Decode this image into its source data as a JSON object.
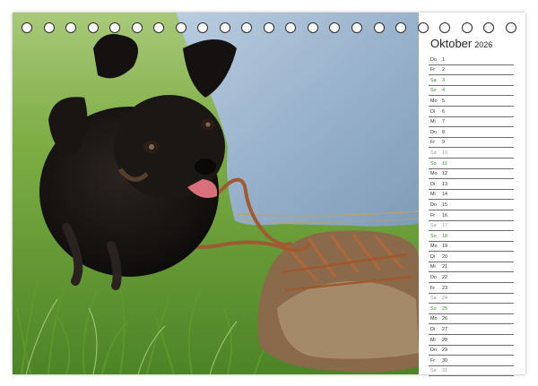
{
  "calendar": {
    "month": "Oktober",
    "year": "2026",
    "ring_count": 23,
    "days": [
      {
        "wd": "Do",
        "d": "1",
        "kind": "weekday"
      },
      {
        "wd": "Fr",
        "d": "2",
        "kind": "weekday"
      },
      {
        "wd": "Sa",
        "d": "3",
        "kind": "sun"
      },
      {
        "wd": "So",
        "d": "4",
        "kind": "sun"
      },
      {
        "wd": "Mo",
        "d": "5",
        "kind": "weekday"
      },
      {
        "wd": "Di",
        "d": "6",
        "kind": "weekday"
      },
      {
        "wd": "Mi",
        "d": "7",
        "kind": "weekday"
      },
      {
        "wd": "Do",
        "d": "8",
        "kind": "weekday"
      },
      {
        "wd": "Fr",
        "d": "9",
        "kind": "weekday"
      },
      {
        "wd": "Sa",
        "d": "10",
        "kind": "sat"
      },
      {
        "wd": "So",
        "d": "11",
        "kind": "sun"
      },
      {
        "wd": "Mo",
        "d": "12",
        "kind": "weekday"
      },
      {
        "wd": "Di",
        "d": "13",
        "kind": "weekday"
      },
      {
        "wd": "Mi",
        "d": "14",
        "kind": "weekday"
      },
      {
        "wd": "Do",
        "d": "15",
        "kind": "weekday"
      },
      {
        "wd": "Fr",
        "d": "16",
        "kind": "weekday"
      },
      {
        "wd": "Sa",
        "d": "17",
        "kind": "sat"
      },
      {
        "wd": "So",
        "d": "18",
        "kind": "sun"
      },
      {
        "wd": "Mo",
        "d": "19",
        "kind": "weekday"
      },
      {
        "wd": "Di",
        "d": "20",
        "kind": "weekday"
      },
      {
        "wd": "Mi",
        "d": "21",
        "kind": "weekday"
      },
      {
        "wd": "Do",
        "d": "22",
        "kind": "weekday"
      },
      {
        "wd": "Fr",
        "d": "23",
        "kind": "weekday"
      },
      {
        "wd": "Sa",
        "d": "24",
        "kind": "sat"
      },
      {
        "wd": "So",
        "d": "25",
        "kind": "sun"
      },
      {
        "wd": "Mo",
        "d": "26",
        "kind": "weekday"
      },
      {
        "wd": "Di",
        "d": "27",
        "kind": "weekday"
      },
      {
        "wd": "Mi",
        "d": "28",
        "kind": "weekday"
      },
      {
        "wd": "Do",
        "d": "29",
        "kind": "weekday"
      },
      {
        "wd": "Fr",
        "d": "30",
        "kind": "weekday"
      },
      {
        "wd": "Sa",
        "d": "31",
        "kind": "sat"
      }
    ]
  },
  "colors": {
    "sunday": "#3b8a3b",
    "saturday": "#9a9a9a",
    "weekday": "#333333",
    "grass": "#6f9f3a",
    "denim": "#9fb6cf"
  },
  "photo": {
    "icons": [
      "puppy-icon",
      "leash-icon",
      "jeans-icon",
      "shoe-icon",
      "grass-icon"
    ]
  }
}
